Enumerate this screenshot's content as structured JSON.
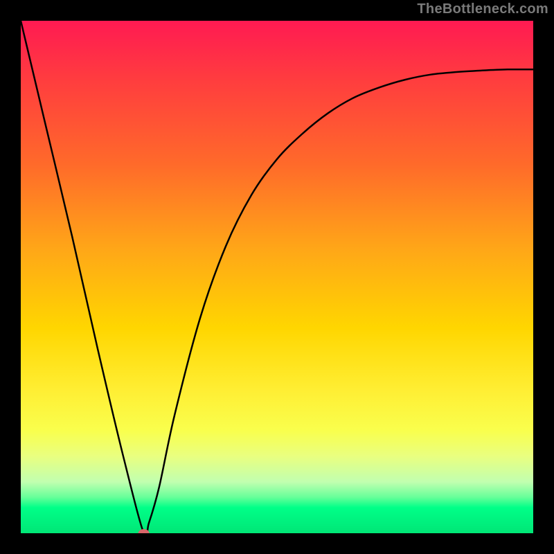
{
  "watermark": "TheBottleneck.com",
  "chart_data": {
    "type": "line",
    "title": "",
    "xlabel": "",
    "ylabel": "",
    "xlim": [
      0,
      100
    ],
    "ylim": [
      0,
      100
    ],
    "x": [
      0,
      5,
      10,
      15,
      20,
      24,
      25,
      27,
      30,
      35,
      40,
      45,
      50,
      55,
      60,
      65,
      70,
      75,
      80,
      85,
      90,
      95,
      100
    ],
    "values": [
      100,
      79,
      58,
      36,
      15,
      0,
      2,
      9,
      23,
      42,
      56,
      66,
      73,
      78,
      82,
      85,
      87,
      88.5,
      89.5,
      90,
      90.3,
      90.5,
      90.5
    ],
    "marker": {
      "x": 24,
      "y": 0,
      "color": "#d9666a"
    },
    "grid": false,
    "legend": false,
    "axes_visible": false,
    "background_gradient": {
      "direction": "vertical",
      "stops": [
        {
          "pos": 0,
          "color": "#ff1a52"
        },
        {
          "pos": 45,
          "color": "#ffa817"
        },
        {
          "pos": 72,
          "color": "#ffee33"
        },
        {
          "pos": 95,
          "color": "#00ff88"
        },
        {
          "pos": 100,
          "color": "#00e676"
        }
      ]
    }
  }
}
